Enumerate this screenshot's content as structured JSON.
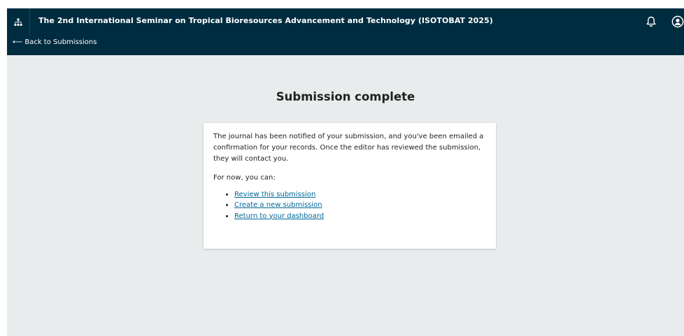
{
  "header": {
    "site_title": "The 2nd International Seminar on Tropical Bioresources Advancement and Technology (ISOTOBAT 2025)",
    "back_link": "Back to Submissions",
    "icons": {
      "site_nav": "sitemap-icon",
      "notifications": "bell-icon",
      "user": "user-circle-icon"
    }
  },
  "main": {
    "title": "Submission complete",
    "message": "The journal has been notified of your submission, and you've been emailed a confirmation for your records. Once the editor has reviewed the submission, they will contact you.",
    "next_steps_label": "For now, you can:",
    "links": [
      {
        "label": "Review this submission"
      },
      {
        "label": "Create a new submission"
      },
      {
        "label": "Return to your dashboard"
      }
    ]
  },
  "colors": {
    "header_bg": "#002c40",
    "page_bg": "#e8ecec",
    "link": "#006798"
  }
}
